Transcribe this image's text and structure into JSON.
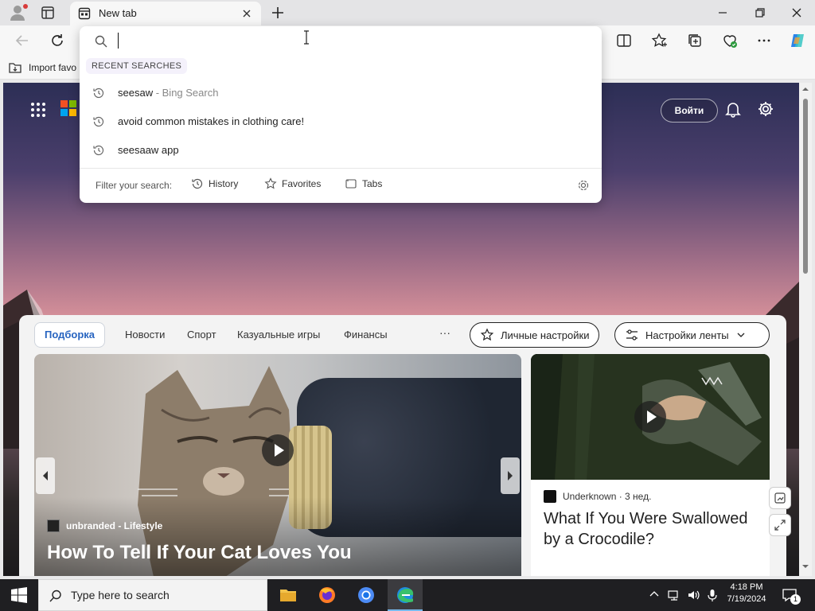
{
  "browser": {
    "tab_title": "New tab",
    "favorites_bar_item": "Import favo"
  },
  "address_dropdown": {
    "input_value": "",
    "recent_header": "RECENT SEARCHES",
    "items": [
      {
        "text": "seesaw",
        "suffix": " - Bing Search"
      },
      {
        "text": "avoid common mistakes in clothing care!",
        "suffix": ""
      },
      {
        "text": "seesaaw app",
        "suffix": ""
      }
    ],
    "filter_label": "Filter your search:",
    "filters": [
      "History",
      "Favorites",
      "Tabs"
    ]
  },
  "page": {
    "login_label": "Войти",
    "feed_tabs": [
      "Подборка",
      "Новости",
      "Спорт",
      "Казуальные игры",
      "Финансы"
    ],
    "more": "···",
    "personal_settings": "Личные настройки",
    "feed_settings": "Настройки ленты",
    "big_card": {
      "source": "unbranded - Lifestyle",
      "title": "How To Tell If Your Cat Loves You"
    },
    "small_card": {
      "source": "Underknown",
      "age": " · 3 нед.",
      "title": "What If You Were Swallowed by a Crocodile?"
    }
  },
  "taskbar": {
    "search_placeholder": "Type here to search",
    "time": "4:18 PM",
    "date": "7/19/2024",
    "notification_count": "1"
  },
  "colors": {
    "accent": "#2764c0",
    "taskbar": "#1f1f22"
  }
}
